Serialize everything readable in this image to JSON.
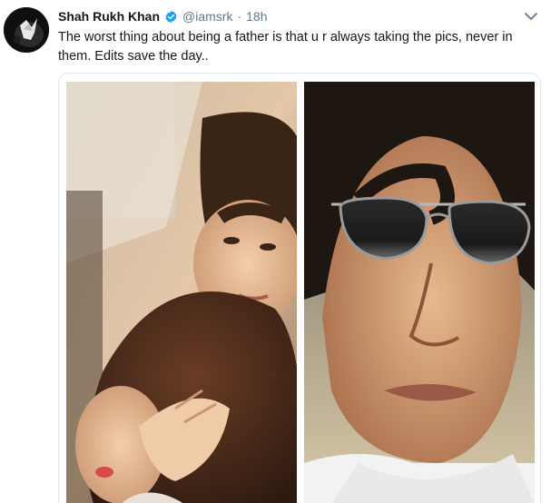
{
  "tweet": {
    "author_name": "Shah Rukh Khan",
    "handle": "@iamsrk",
    "separator": "·",
    "timestamp": "18h",
    "text": "The worst thing about being a father is that u r always taking the pics, never in them. Edits save the day..",
    "verified": true
  },
  "icons": {
    "verified": "verified-badge-icon",
    "menu": "chevron-down-icon"
  },
  "media": {
    "count": 2
  },
  "colors": {
    "name": "#14171a",
    "secondary": "#657786",
    "verified_blue": "#1da1f2",
    "border": "#e1e8ed"
  }
}
